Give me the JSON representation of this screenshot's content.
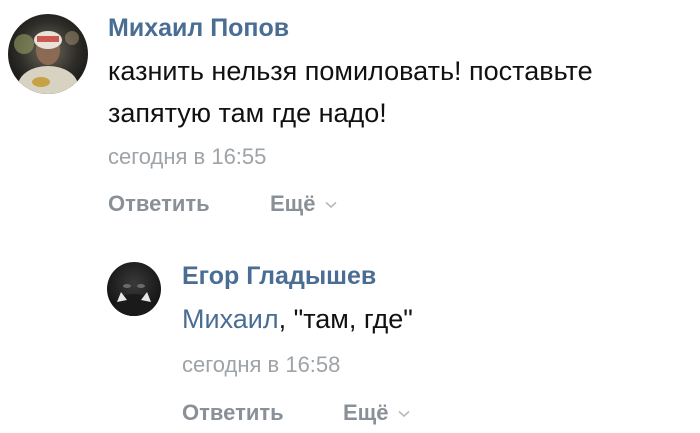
{
  "comments": [
    {
      "author": "Михаил Попов",
      "text_lines": [
        "казнить нельзя помиловать! поставьте",
        "запятую там где надо!"
      ],
      "time": "сегодня в 16:55",
      "reply_label": "Ответить",
      "more_label": "Ещё"
    },
    {
      "author": "Егор Гладышев",
      "mention": "Михаил",
      "text_rest": ", \"там, где\"",
      "time": "сегодня в 16:58",
      "reply_label": "Ответить",
      "more_label": "Ещё"
    }
  ],
  "colors": {
    "author": "#4a6d94",
    "text": "#111111",
    "meta": "#9ea3a8",
    "action": "#8a9098",
    "background": "#ffffff"
  },
  "icons": {
    "more_chevron": "chevron-down-icon"
  }
}
